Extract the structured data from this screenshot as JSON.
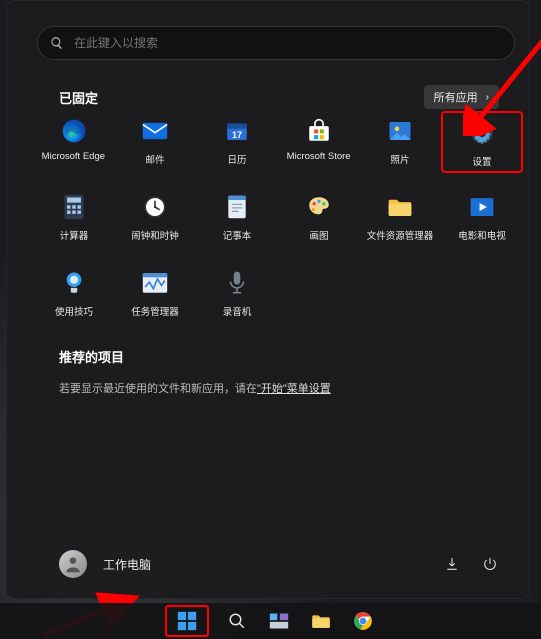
{
  "search": {
    "placeholder": "在此键入以搜索"
  },
  "pinned": {
    "title": "已固定",
    "all_apps_label": "所有应用",
    "apps": [
      {
        "name": "edge",
        "label": "Microsoft Edge"
      },
      {
        "name": "mail",
        "label": "邮件"
      },
      {
        "name": "calendar",
        "label": "日历"
      },
      {
        "name": "store",
        "label": "Microsoft Store"
      },
      {
        "name": "photos",
        "label": "照片"
      },
      {
        "name": "settings",
        "label": "设置"
      },
      {
        "name": "calculator",
        "label": "计算器"
      },
      {
        "name": "clock",
        "label": "闹钟和时钟"
      },
      {
        "name": "notepad",
        "label": "记事本"
      },
      {
        "name": "paint",
        "label": "画图"
      },
      {
        "name": "explorer",
        "label": "文件资源管理器"
      },
      {
        "name": "movies",
        "label": "电影和电视"
      },
      {
        "name": "tips",
        "label": "使用技巧"
      },
      {
        "name": "taskmgr",
        "label": "任务管理器"
      },
      {
        "name": "recorder",
        "label": "录音机"
      }
    ]
  },
  "recommended": {
    "title": "推荐的项目",
    "hint_prefix": "若要显示最近使用的文件和新应用，请在",
    "hint_link": "\"开始\"菜单设置"
  },
  "user": {
    "label": "工作电脑"
  },
  "colors": {
    "highlight": "#ff0000"
  }
}
